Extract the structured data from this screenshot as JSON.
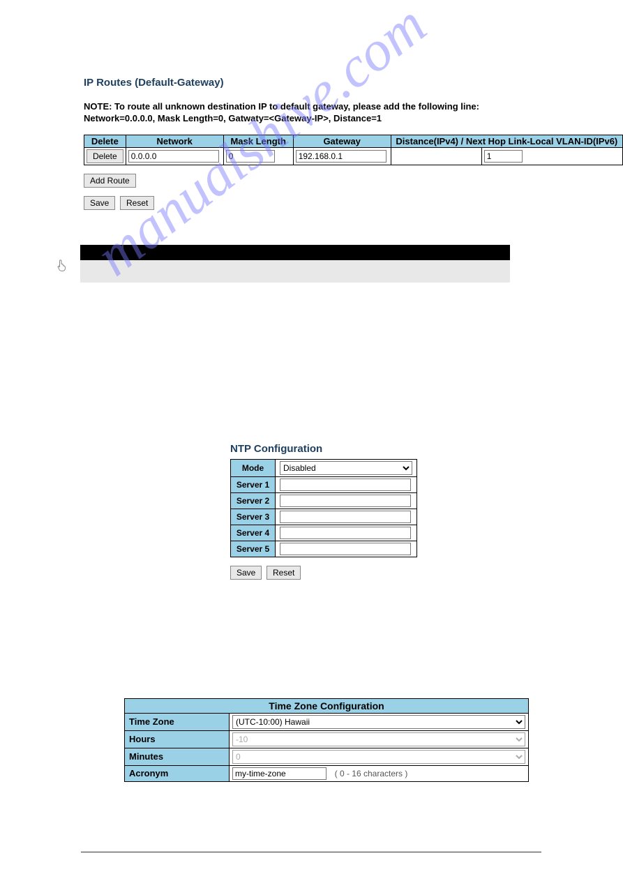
{
  "ip_routes": {
    "title": "IP Routes (Default-Gateway)",
    "note_line1": "NOTE: To route all unknown destination IP to default gateway, please add the following line:",
    "note_line2": "Network=0.0.0.0, Mask Length=0, Gatwaty=<Gateway-IP>, Distance=1",
    "headers": {
      "delete": "Delete",
      "network": "Network",
      "mask_length": "Mask Length",
      "gateway": "Gateway",
      "distance": "Distance(IPv4) / Next Hop Link-Local VLAN-ID(IPv6)"
    },
    "row": {
      "delete_btn": "Delete",
      "network": "0.0.0.0",
      "mask_length": "0",
      "gateway": "192.168.0.1",
      "distance_a": "",
      "distance_b": "1"
    },
    "add_btn": "Add Route",
    "save_btn": "Save",
    "reset_btn": "Reset"
  },
  "ntp": {
    "title": "NTP Configuration",
    "mode_label": "Mode",
    "mode_value": "Disabled",
    "s1_label": "Server 1",
    "s2_label": "Server 2",
    "s3_label": "Server 3",
    "s4_label": "Server 4",
    "s5_label": "Server 5",
    "s1_value": "",
    "s2_value": "",
    "s3_value": "",
    "s4_value": "",
    "s5_value": "",
    "save_btn": "Save",
    "reset_btn": "Reset"
  },
  "tz": {
    "title": "Time Zone Configuration",
    "zone_label": "Time Zone",
    "zone_value": "(UTC-10:00) Hawaii",
    "hours_label": "Hours",
    "hours_value": "-10",
    "minutes_label": "Minutes",
    "minutes_value": "0",
    "acronym_label": "Acronym",
    "acronym_value": "my-time-zone",
    "acronym_hint": "( 0 - 16 characters )"
  },
  "watermark": "manualshive.com"
}
